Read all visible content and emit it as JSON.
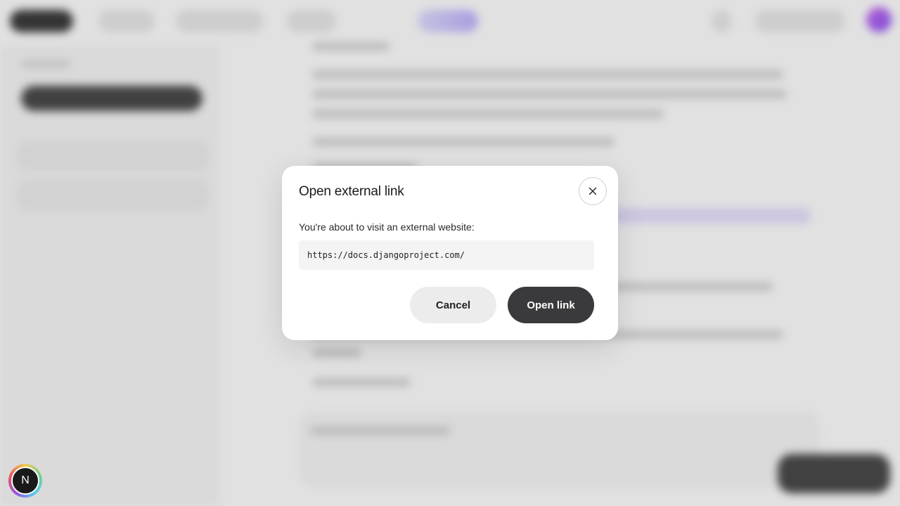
{
  "modal": {
    "title": "Open external link",
    "description": "You're about to visit an external website:",
    "url": "https://docs.djangoproject.com/",
    "cancel_label": "Cancel",
    "open_label": "Open link",
    "close_icon": "close-icon"
  },
  "badge": {
    "letter": "N"
  },
  "colors": {
    "primary_button": "#3a3a3c",
    "secondary_button": "#ececec",
    "accent_purple": "#b9a8ff"
  }
}
